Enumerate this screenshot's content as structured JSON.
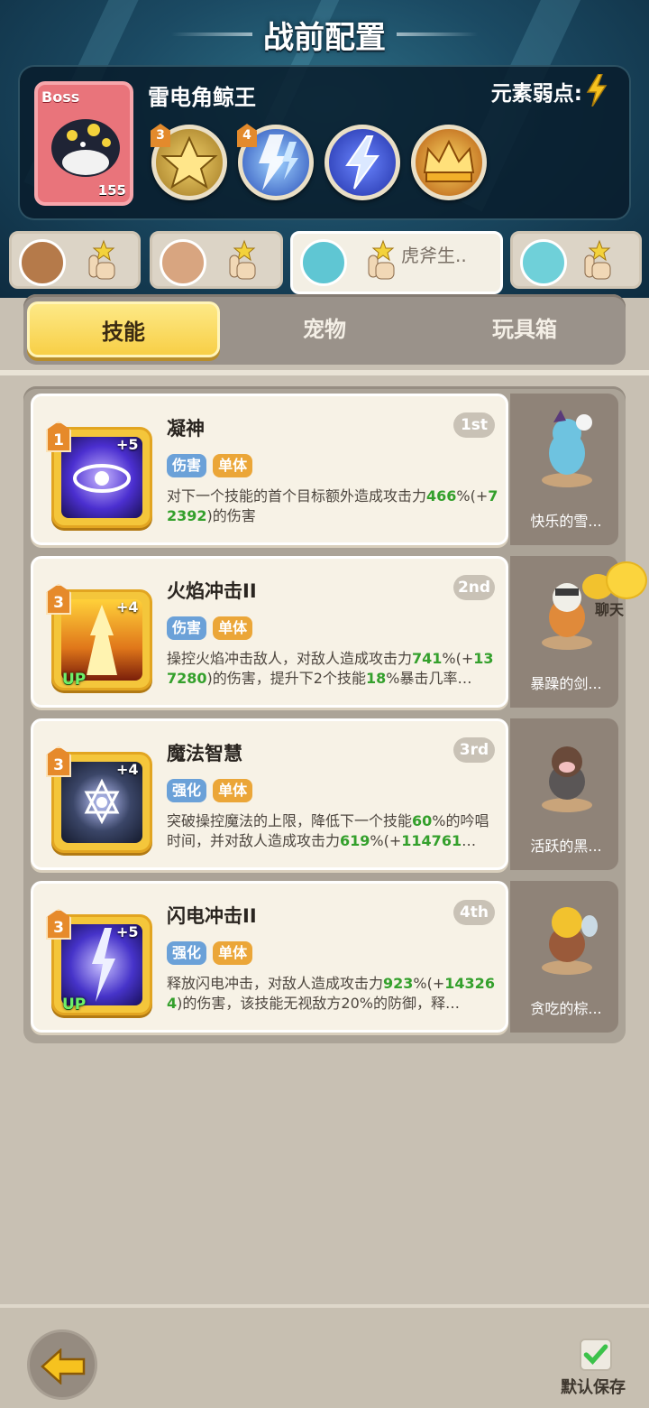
{
  "header": {
    "title": "战前配置"
  },
  "boss": {
    "tag": "Boss",
    "level": "155",
    "name": "雷电角鲸王",
    "weakness_label": "元素弱点:",
    "weakness_icon": "lightning-icon",
    "skills": [
      {
        "badge": "3",
        "icon": "gold-crest-icon",
        "color": "#c8a140"
      },
      {
        "badge": "4",
        "icon": "lightning-storm-icon",
        "color": "#3d6fd8"
      },
      {
        "badge": "",
        "icon": "lightning-bolt-icon",
        "color": "#3f57d6"
      },
      {
        "badge": "",
        "icon": "gold-crown-icon",
        "color": "#e08a1e"
      }
    ]
  },
  "team": [
    {
      "name": "",
      "active": false
    },
    {
      "name": "",
      "active": false
    },
    {
      "name": "虎斧生..",
      "active": true
    },
    {
      "name": "",
      "active": false
    }
  ],
  "tabs": [
    {
      "label": "技能",
      "active": true
    },
    {
      "label": "宠物",
      "active": false
    },
    {
      "label": "玩具箱",
      "active": false
    }
  ],
  "skills": [
    {
      "name": "凝神",
      "order": "1st",
      "level": "1",
      "plus": "+5",
      "up": "",
      "tags": [
        "伤害",
        "单体"
      ],
      "desc_parts": [
        {
          "t": "对下一个技能的首个目标额外造成攻击力",
          "g": false
        },
        {
          "t": "466",
          "g": true
        },
        {
          "t": "%(+",
          "g": false
        },
        {
          "t": "72392",
          "g": true
        },
        {
          "t": ")的伤害",
          "g": false
        }
      ],
      "icon_color": "#4b2fd0",
      "pet": "快乐的雪..."
    },
    {
      "name": "火焰冲击II",
      "order": "2nd",
      "level": "3",
      "plus": "+4",
      "up": "UP",
      "tags": [
        "伤害",
        "单体"
      ],
      "desc_parts": [
        {
          "t": "操控火焰冲击敌人，对敌人造成攻击力",
          "g": false
        },
        {
          "t": "741",
          "g": true
        },
        {
          "t": "%(+",
          "g": false
        },
        {
          "t": "137280",
          "g": true
        },
        {
          "t": ")的伤害，提升下2个技能",
          "g": false
        },
        {
          "t": "18",
          "g": true
        },
        {
          "t": "%暴击几率…",
          "g": false
        }
      ],
      "icon_color": "#e0771a",
      "pet": "暴躁的剑..."
    },
    {
      "name": "魔法智慧",
      "order": "3rd",
      "level": "3",
      "plus": "+4",
      "up": "",
      "tags": [
        "强化",
        "单体"
      ],
      "desc_parts": [
        {
          "t": "突破操控魔法的上限，降低下一个技能",
          "g": false
        },
        {
          "t": "60",
          "g": true
        },
        {
          "t": "%的吟唱时间，并对敌人造成攻击力",
          "g": false
        },
        {
          "t": "619",
          "g": true
        },
        {
          "t": "%(+",
          "g": false
        },
        {
          "t": "114761",
          "g": true
        },
        {
          "t": "…",
          "g": false
        }
      ],
      "icon_color": "#3b4668",
      "pet": "活跃的黑..."
    },
    {
      "name": "闪电冲击II",
      "order": "4th",
      "level": "3",
      "plus": "+5",
      "up": "UP",
      "tags": [
        "强化",
        "单体"
      ],
      "desc_parts": [
        {
          "t": "释放闪电冲击，对敌人造成攻击力",
          "g": false
        },
        {
          "t": "923",
          "g": true
        },
        {
          "t": "%(+",
          "g": false
        },
        {
          "t": "143264",
          "g": true
        },
        {
          "t": ")的伤害，该技能无视敌方20%的防御，释…",
          "g": false
        }
      ],
      "icon_color": "#4633c9",
      "pet": "贪吃的棕..."
    }
  ],
  "chat": {
    "label": "聊天"
  },
  "footer": {
    "save_label": "默认保存"
  }
}
